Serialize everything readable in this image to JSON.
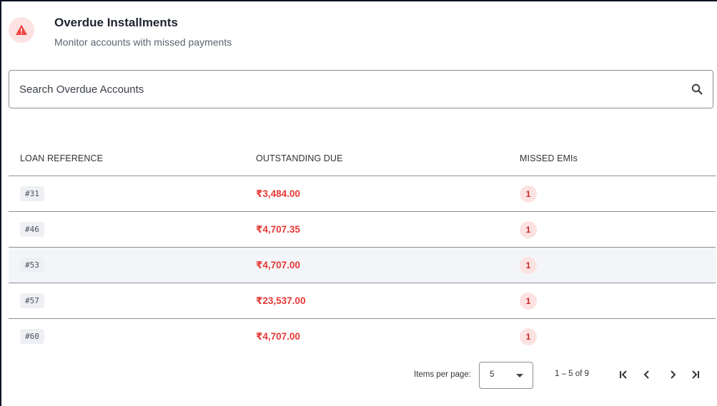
{
  "header": {
    "title": "Overdue Installments",
    "subtitle": "Monitor accounts with missed payments",
    "icon": "warning-icon",
    "accent": "#e53935"
  },
  "search": {
    "placeholder": "Search Overdue Accounts",
    "value": "",
    "icon": "search-icon"
  },
  "table": {
    "columns": [
      "LOAN REFERENCE",
      "OUTSTANDING DUE",
      "MISSED EMIs"
    ],
    "rows": [
      {
        "ref": "#31",
        "due": "₹3,484.00",
        "missed": "1"
      },
      {
        "ref": "#46",
        "due": "₹4,707.35",
        "missed": "1"
      },
      {
        "ref": "#53",
        "due": "₹4,707.00",
        "missed": "1"
      },
      {
        "ref": "#57",
        "due": "₹23,537.00",
        "missed": "1"
      },
      {
        "ref": "#60",
        "due": "₹4,707.00",
        "missed": "1"
      }
    ],
    "highlighted_row": 2
  },
  "paginator": {
    "items_per_page_label": "Items per page:",
    "items_per_page_value": "5",
    "range_label": "1 – 5 of 9",
    "buttons": [
      "first-page-icon",
      "previous-page-icon",
      "next-page-icon",
      "last-page-icon"
    ]
  }
}
